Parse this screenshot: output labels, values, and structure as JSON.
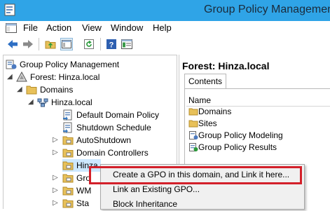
{
  "window": {
    "title": "Group Policy Management"
  },
  "menubar": {
    "items": [
      "File",
      "Action",
      "View",
      "Window",
      "Help"
    ]
  },
  "toolbar": {
    "buttons": [
      "back-icon",
      "forward-icon",
      "up-folder-icon",
      "show-hide-tree-icon",
      "refresh-icon",
      "help-icon",
      "properties-icon"
    ]
  },
  "tree": {
    "root": "Group Policy Management",
    "forest": "Forest: Hinza.local",
    "domains": "Domains",
    "domain": "Hinza.local",
    "items": {
      "default_policy": "Default Domain Policy",
      "shutdown_schedule": "Shutdown Schedule",
      "autoshutdown": "AutoShutdown",
      "domain_controllers": "Domain Controllers",
      "hinza": "Hinza",
      "gro": "Gro",
      "wm": "WM",
      "sta": "Sta"
    }
  },
  "right_pane": {
    "header": "Forest: Hinza.local",
    "tab": "Contents",
    "column": "Name",
    "items": [
      "Domains",
      "Sites",
      "Group Policy Modeling",
      "Group Policy Results"
    ]
  },
  "context_menu": {
    "items": [
      "Create a GPO in this domain, and Link it here...",
      "Link an Existing GPO...",
      "Block Inheritance"
    ]
  },
  "colors": {
    "titlebar": "#2fa4e7",
    "highlight_box": "#d3202a",
    "selection": "#cde8ff"
  }
}
